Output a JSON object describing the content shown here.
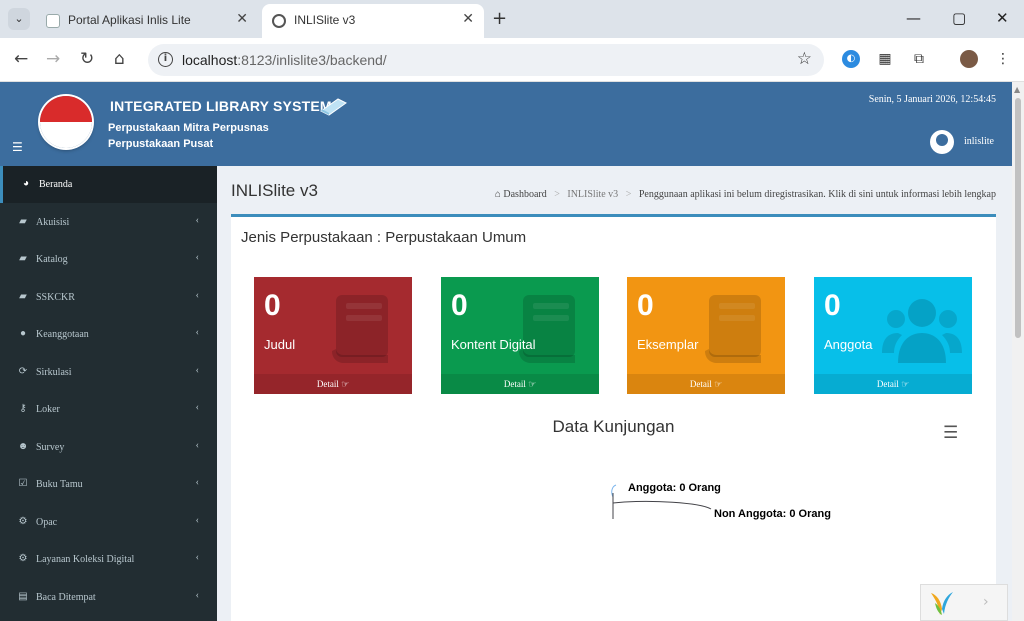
{
  "browser": {
    "tabs": [
      {
        "title": "Portal Aplikasi Inlis Lite",
        "active": false
      },
      {
        "title": "INLISlite v3",
        "active": true
      }
    ],
    "url_host": "localhost",
    "url_path": ":8123/inlislite3/backend/"
  },
  "header": {
    "system_title": "INTEGRATED LIBRARY SYSTEM",
    "library_line1": "Perpustakaan Mitra Perpusnas",
    "library_line2": "Perpustakaan Pusat",
    "datetime": "Senin, 5 Januari 2026, 12:54:45",
    "username": "inlislite"
  },
  "sidebar": {
    "items": [
      {
        "label": "Beranda",
        "icon": "dashboard-icon",
        "glyph": "◕",
        "active": true
      },
      {
        "label": "Akuisisi",
        "icon": "book-icon",
        "glyph": "▰"
      },
      {
        "label": "Katalog",
        "icon": "book-icon",
        "glyph": "▰"
      },
      {
        "label": "SSKCKR",
        "icon": "book-icon",
        "glyph": "▰"
      },
      {
        "label": "Keanggotaan",
        "icon": "user-icon",
        "glyph": "●"
      },
      {
        "label": "Sirkulasi",
        "icon": "refresh-icon",
        "glyph": "⟳"
      },
      {
        "label": "Loker",
        "icon": "key-icon",
        "glyph": "⚷"
      },
      {
        "label": "Survey",
        "icon": "users-icon",
        "glyph": "☻"
      },
      {
        "label": "Buku Tamu",
        "icon": "check-square-icon",
        "glyph": "☑"
      },
      {
        "label": "Opac",
        "icon": "cogs-icon",
        "glyph": "⚙"
      },
      {
        "label": "Layanan Koleksi Digital",
        "icon": "cogs-icon",
        "glyph": "⚙"
      },
      {
        "label": "Baca Ditempat",
        "icon": "book-open-icon",
        "glyph": "▤"
      }
    ]
  },
  "content": {
    "page_title": "INLISlite v3",
    "breadcrumb": {
      "home": "Dashboard",
      "current": "INLISlite v3",
      "notice": "Penggunaan aplikasi ini belum diregistrasikan. Klik di sini untuk informasi lebih lengkap"
    },
    "box_title": "Jenis Perpustakaan : Perpustakaan Umum",
    "stats": [
      {
        "value": "0",
        "label": "Judul",
        "detail": "Detail",
        "color": "#a52a2f",
        "footer_color": "#95252a",
        "icon": "book-icon"
      },
      {
        "value": "0",
        "label": "Kontent Digital",
        "detail": "Detail",
        "color": "#0a9a4f",
        "footer_color": "#098a46",
        "icon": "book-icon"
      },
      {
        "value": "0",
        "label": "Eksemplar",
        "detail": "Detail",
        "color": "#f29512",
        "footer_color": "#da850f",
        "icon": "book-icon"
      },
      {
        "value": "0",
        "label": "Anggota",
        "detail": "Detail",
        "color": "#07bfe9",
        "footer_color": "#06acd2",
        "icon": "users-icon"
      }
    ]
  },
  "chart_data": {
    "type": "pie",
    "title": "Data Kunjungan",
    "slices": [
      {
        "name": "Anggota",
        "label": "Anggota: 0 Orang",
        "value": 0
      },
      {
        "name": "Non Anggota",
        "label": "Non Anggota: 0 Orang",
        "value": 0
      }
    ]
  }
}
